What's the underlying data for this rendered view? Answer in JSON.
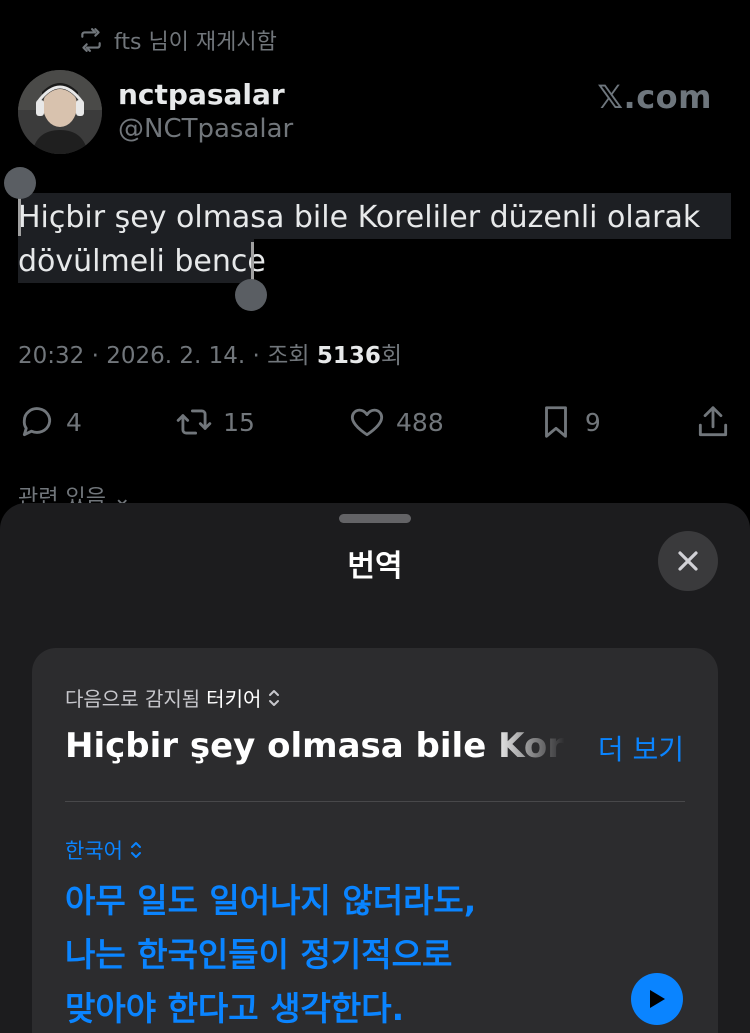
{
  "repost": {
    "icon": "repost-icon",
    "text": "fts 님이 재게시함"
  },
  "user": {
    "name": "nctpasalar",
    "handle": "@NCTpasalar",
    "avatar_icon": "avatar"
  },
  "brand": "𝕏.com",
  "tweet": {
    "line1": "Hiçbir şey olmasa bile Koreliler düzenli olarak",
    "line2": "dövülmeli bence"
  },
  "meta": {
    "time": "20:32",
    "separator": " · ",
    "date": "2026. 2. 14.",
    "views_label": "조회",
    "views_count": "5136",
    "views_suffix": "회"
  },
  "actions": {
    "replies": "4",
    "reposts": "15",
    "likes": "488",
    "bookmarks": "9"
  },
  "related_text": "관련 있음",
  "sheet": {
    "title": "번역",
    "close_icon": "close-icon",
    "detected_label": "다음으로 감지됨",
    "detected_language": "터키어",
    "source_preview": "Hiçbir şey olmasa bile Koreliler düzenli olarak dövülmeli bence",
    "more_label": "더 보기",
    "target_language": "한국어",
    "translation_lines": [
      "아무 일도 일어나지 않더라도,",
      "나는 한국인들이 정기적으로",
      "맞아야 한다고 생각한다."
    ]
  },
  "colors": {
    "background": "#000000",
    "muted": "#71767b",
    "accent": "#0a84ff",
    "sheet": "#1c1c1e",
    "card": "#2c2c2e"
  }
}
